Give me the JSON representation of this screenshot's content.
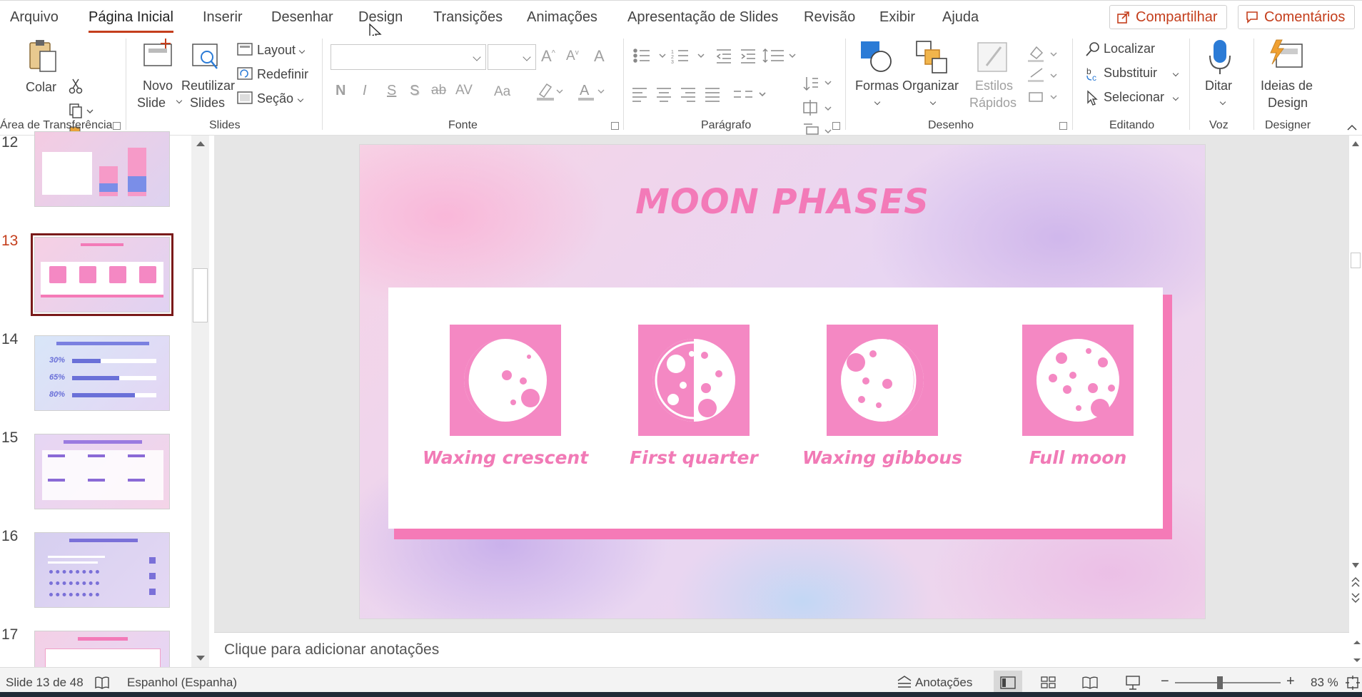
{
  "tabs": [
    "Arquivo",
    "Página Inicial",
    "Inserir",
    "Desenhar",
    "Design",
    "Transições",
    "Animações",
    "Apresentação de Slides",
    "Revisão",
    "Exibir",
    "Ajuda"
  ],
  "share_label": "Compartilhar",
  "comments_label": "Comentários",
  "ribbon": {
    "clipboard": {
      "paste": "Colar",
      "group": "Área de Transferência"
    },
    "slides": {
      "new_slide_1": "Novo",
      "new_slide_2": "Slide",
      "reuse_1": "Reutilizar",
      "reuse_2": "Slides",
      "layout": "Layout",
      "reset": "Redefinir",
      "section": "Seção",
      "group": "Slides"
    },
    "font": {
      "bold": "N",
      "italic": "I",
      "underline": "S",
      "shadow": "S",
      "strike": "ab",
      "spacing": "AV",
      "case": "Aa",
      "group": "Fonte"
    },
    "paragraph": {
      "group": "Parágrafo"
    },
    "drawing": {
      "shapes": "Formas",
      "arrange": "Organizar",
      "quick_styles_1": "Estilos",
      "quick_styles_2": "Rápidos",
      "group": "Desenho"
    },
    "editing": {
      "find": "Localizar",
      "replace": "Substituir",
      "select": "Selecionar",
      "group": "Editando"
    },
    "voice": {
      "dictate": "Ditar",
      "group": "Voz"
    },
    "designer": {
      "ideas_1": "Ideias de",
      "ideas_2": "Design",
      "group": "Designer"
    }
  },
  "slide_numbers": [
    "12",
    "13",
    "14",
    "15",
    "16",
    "17"
  ],
  "current_slide_index": 1,
  "thumb14_pcts": [
    "30%",
    "65%",
    "80%"
  ],
  "slide": {
    "title": "MOON PHASES",
    "phases": [
      "Waxing crescent",
      "First quarter",
      "Waxing gibbous",
      "Full moon"
    ]
  },
  "notes_placeholder": "Clique para adicionar anotações",
  "status": {
    "slide_info": "Slide 13 de 48",
    "language": "Espanhol (Espanha)",
    "notes": "Anotações",
    "zoom_minus": "−",
    "zoom_plus": "+",
    "zoom": "83 %"
  },
  "colors": {
    "accent": "#c43e1c",
    "slide_pink": "#f488c3",
    "title_pink": "#f37ab8"
  }
}
